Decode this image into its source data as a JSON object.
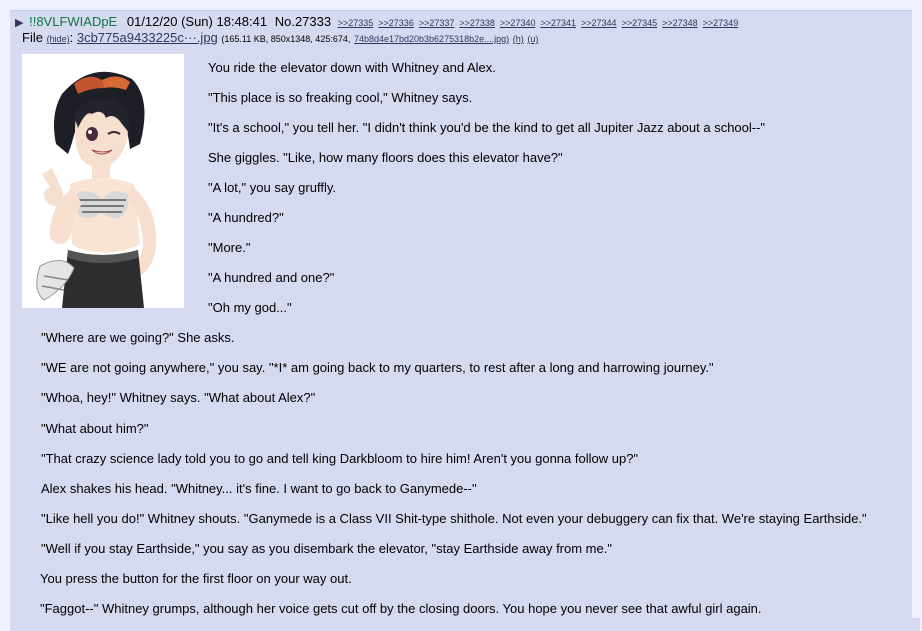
{
  "post": {
    "arrow": "▶",
    "name": "!!8VLFWIADpE",
    "datetime": "01/12/20 (Sun) 18:48:41",
    "number": "No.27333",
    "replies": [
      ">>27335",
      ">>27336",
      ">>27337",
      ">>27338",
      ">>27340",
      ">>27341",
      ">>27344",
      ">>27345",
      ">>27348",
      ">>27349"
    ]
  },
  "file": {
    "label": "File",
    "hide": "(hide)",
    "colon": ":",
    "filename": "3cb775a9433225c···.jpg",
    "info": "(165.11 KB, 850x1348, 425:674,",
    "hash": "74b8d4e17bd20b3b6275318b2e....jpg)",
    "h": "(h)",
    "u": "(u)"
  },
  "lines": [
    "You ride the elevator down with Whitney and Alex.",
    "\"This place is so freaking cool,\" Whitney says.",
    "\"It's a school,\" you tell her. \"I didn't think you'd be the kind to get all Jupiter Jazz about a school--\"",
    "She giggles. \"Like, how many floors does this elevator have?\"",
    "\"A lot,\" you say gruffly.",
    "\"A hundred?\"",
    "\"More.\"",
    "\"A hundred and one?\"",
    "\"Oh my god...\"",
    "\"Where are we going?\" She asks.",
    "\"WE are not going anywhere,\" you say. \"*I* am going back to my quarters, to rest after a long and harrowing journey.\"",
    "\"Whoa, hey!\" Whitney says. \"What about Alex?\"",
    "\"What about him?\"",
    "\"That crazy science lady told you to go and tell king Darkbloom to hire him! Aren't you gonna follow up?\"",
    "Alex shakes his head. \"Whitney... it's fine. I want to go back to Ganymede--\"",
    "\"Like hell you do!\" Whitney shouts. \"Ganymede is a Class VII Shit-type shithole. Not even your debuggery can fix that. We're staying Earthside.\"",
    "\"Well if you stay Earthside,\" you say as you disembark the elevator, \"stay Earthside away from me.\"",
    "You press the button for the first floor on your way out.",
    "\"Faggot--\" Whitney grumps, although her voice gets cut off by the closing doors. You hope you never see that awful girl again."
  ],
  "colors": {
    "post_bg": "#d6daf0",
    "page_bg": "#eef2ff",
    "name": "#117743",
    "link": "#34345c"
  }
}
